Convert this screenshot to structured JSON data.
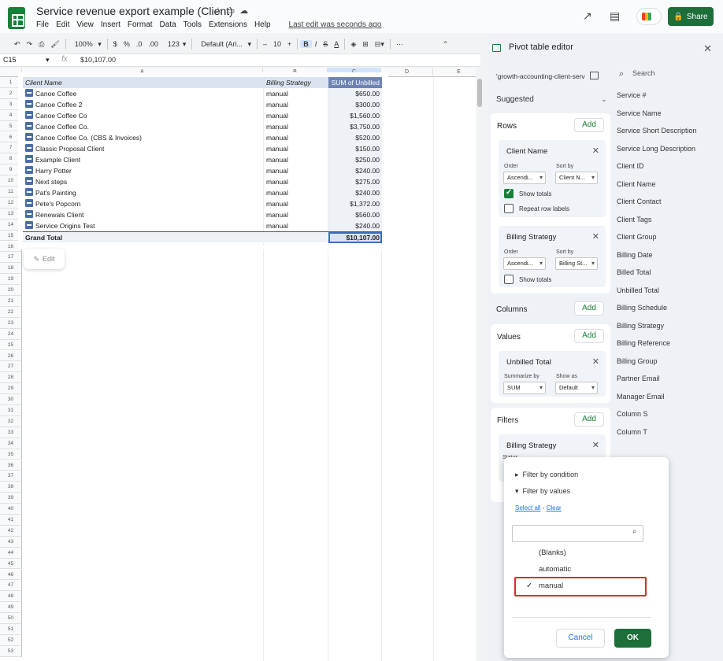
{
  "header": {
    "doc_title": "Service revenue export example (Client)",
    "menu": [
      "File",
      "Edit",
      "View",
      "Insert",
      "Format",
      "Data",
      "Tools",
      "Extensions",
      "Help"
    ],
    "last_edit": "Last edit was seconds ago",
    "share_label": "Share"
  },
  "toolbar": {
    "zoom": "100%",
    "currency": "$",
    "percent": "%",
    "dec_less": ".0",
    "dec_more": ".00",
    "num_format": "123",
    "font": "Default (Ari...",
    "font_size": "10",
    "bold": "B",
    "italic": "I",
    "strike": "S",
    "text_color": "A"
  },
  "formula_bar": {
    "cell_ref": "C15",
    "fx": "fx",
    "value": "$10,107.00"
  },
  "sheet": {
    "columns": [
      "A",
      "B",
      "C",
      "D",
      "E"
    ],
    "row_numbers": [
      "1",
      "2",
      "3",
      "4",
      "5",
      "6",
      "7",
      "8",
      "9",
      "10",
      "11",
      "12",
      "13",
      "14",
      "15",
      "16",
      "17",
      "18",
      "19",
      "20",
      "21",
      "22",
      "23",
      "24",
      "25",
      "26",
      "27",
      "28",
      "29",
      "30",
      "31",
      "32",
      "33",
      "34",
      "35",
      "36",
      "37",
      "38",
      "39",
      "40",
      "41",
      "42",
      "43",
      "44",
      "45",
      "46",
      "47",
      "48",
      "49",
      "50",
      "51",
      "52",
      "53"
    ],
    "pivot_headers": [
      "Client Name",
      "Billing Strategy",
      "SUM of Unbilled"
    ],
    "pivot_rows": [
      {
        "client": "Canoe Coffee",
        "strategy": "manual",
        "sum": "$650.00"
      },
      {
        "client": "Canoe Coffee 2",
        "strategy": "manual",
        "sum": "$300.00"
      },
      {
        "client": "Canoe Coffee Co",
        "strategy": "manual",
        "sum": "$1,560.00"
      },
      {
        "client": "Canoe Coffee Co.",
        "strategy": "manual",
        "sum": "$3,750.00"
      },
      {
        "client": "Canoe Coffee Co. (CBS & Invoices)",
        "strategy": "manual",
        "sum": "$520.00"
      },
      {
        "client": "Classic Proposal Client",
        "strategy": "manual",
        "sum": "$150.00"
      },
      {
        "client": "Example Client",
        "strategy": "manual",
        "sum": "$250.00"
      },
      {
        "client": "Harry Potter",
        "strategy": "manual",
        "sum": "$240.00"
      },
      {
        "client": "Next steps",
        "strategy": "manual",
        "sum": "$275.00"
      },
      {
        "client": "Pat's Painting",
        "strategy": "manual",
        "sum": "$240.00"
      },
      {
        "client": "Pete's Popcorn",
        "strategy": "manual",
        "sum": "$1,372.00"
      },
      {
        "client": "Renewals Client",
        "strategy": "manual",
        "sum": "$560.00"
      },
      {
        "client": "Service Origins Test",
        "strategy": "manual",
        "sum": "$240.00"
      }
    ],
    "grand_total_label": "Grand Total",
    "grand_total_value": "$10,107.00",
    "edit_label": "Edit"
  },
  "panel": {
    "title": "Pivot table editor",
    "range": "'growth-accounting-client-serv",
    "suggested": "Suggested",
    "add_label": "Add",
    "rows": {
      "title": "Rows",
      "cards": [
        {
          "title": "Client Name",
          "order_label": "Order",
          "order_value": "Ascendi...",
          "sort_label": "Sort by",
          "sort_value": "Client N...",
          "show_totals": "Show totals",
          "repeat_labels": "Repeat row labels"
        },
        {
          "title": "Billing Strategy",
          "order_label": "Order",
          "order_value": "Ascendi...",
          "sort_label": "Sort by",
          "sort_value": "Billing St...",
          "show_totals": "Show totals"
        }
      ]
    },
    "columns_title": "Columns",
    "values": {
      "title": "Values",
      "card_title": "Unbilled Total",
      "summarize_label": "Summarize by",
      "summarize_value": "SUM",
      "show_as_label": "Show as",
      "show_as_value": "Default"
    },
    "filters": {
      "title": "Filters",
      "card_title": "Billing Strategy",
      "status_label": "Status"
    },
    "search_placeholder": "Search",
    "fields": [
      "Service #",
      "Service Name",
      "Service Short Description",
      "Service Long Description",
      "Client ID",
      "Client Name",
      "Client Contact",
      "Client Tags",
      "Client Group",
      "Billing Date",
      "Billed Total",
      "Unbilled Total",
      "Billing Schedule",
      "Billing Strategy",
      "Billing Reference",
      "Billing Group",
      "Partner Email",
      "Manager Email",
      "Column S",
      "Column T"
    ]
  },
  "filter_popup": {
    "by_condition": "Filter by condition",
    "by_values": "Filter by values",
    "select_all": "Select all",
    "separator": " - ",
    "clear": "Clear",
    "values": [
      "(Blanks)",
      "automatic",
      "manual"
    ],
    "cancel": "Cancel",
    "ok": "OK"
  }
}
